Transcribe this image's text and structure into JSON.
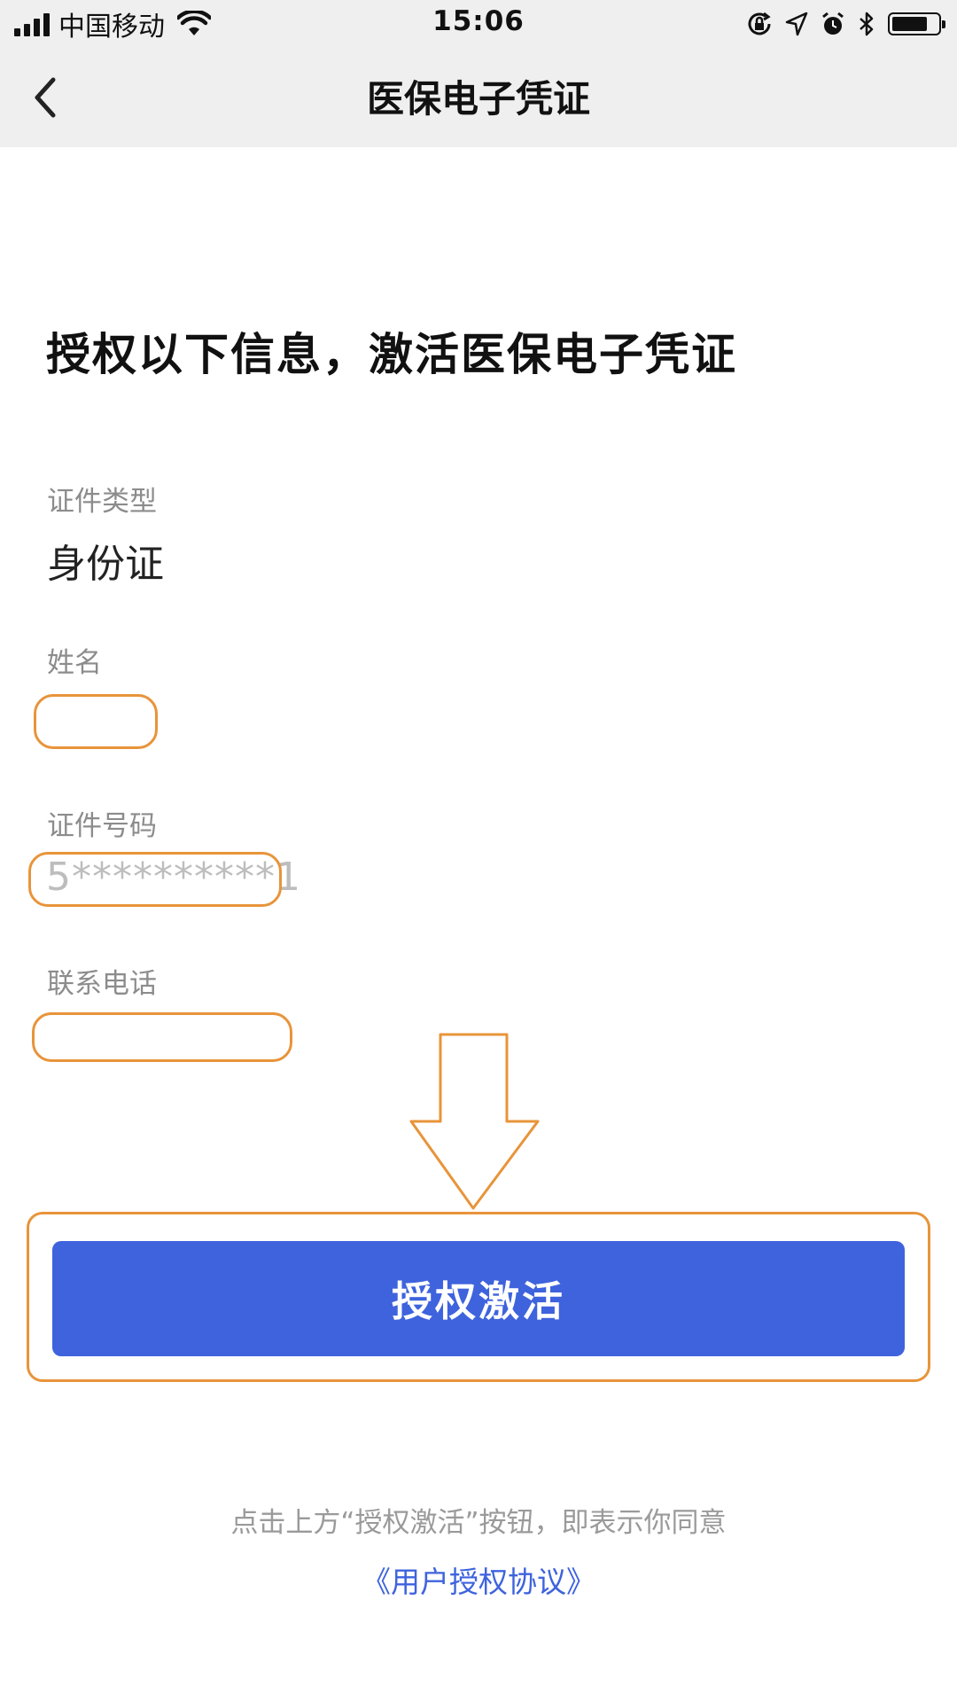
{
  "status_bar": {
    "carrier": "中国移动",
    "time": "15:06"
  },
  "nav": {
    "title": "医保电子凭证"
  },
  "main": {
    "heading": "授权以下信息，激活医保电子凭证",
    "fields": [
      {
        "label": "证件类型",
        "value": "身份证"
      },
      {
        "label": "姓名",
        "value": ""
      },
      {
        "label": "证件号码",
        "value": "5**********1"
      },
      {
        "label": "联系电话",
        "value": ""
      }
    ],
    "activate_button": "授权激活",
    "agreement_note": "点击上方“授权激活”按钮，即表示你同意",
    "agreement_link": "《用户授权协议》"
  },
  "colors": {
    "primary": "#3e63dd",
    "annotation": "#e8943a",
    "nav_bg": "#efefef"
  },
  "icons": [
    "signal-icon",
    "wifi-icon",
    "back-chevron-icon",
    "rotation-lock-icon",
    "location-icon",
    "alarm-icon",
    "bluetooth-icon",
    "battery-icon",
    "down-arrow-annotation-icon"
  ]
}
